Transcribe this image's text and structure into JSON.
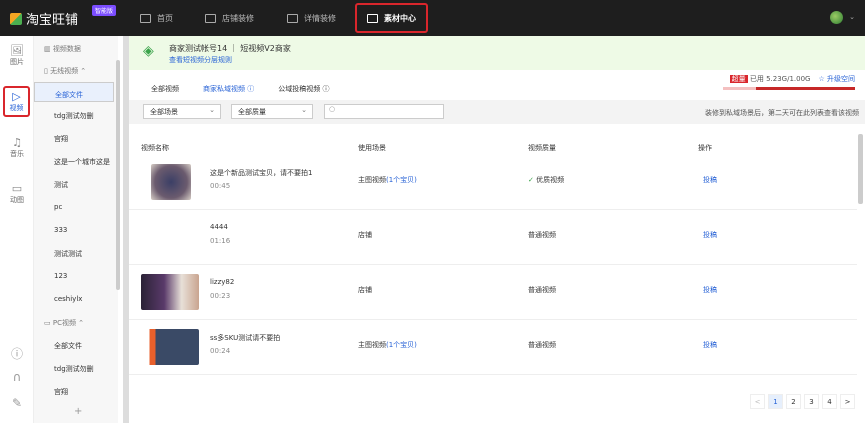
{
  "topbar": {
    "logo": "淘宝旺铺",
    "edition_badge": "智能版",
    "nav": [
      {
        "label": "首页",
        "icon": "home-icon"
      },
      {
        "label": "店铺装修",
        "icon": "store-icon"
      },
      {
        "label": "详情装修",
        "icon": "detail-icon"
      },
      {
        "label": "素材中心",
        "icon": "folder-icon",
        "active": true
      }
    ]
  },
  "rail": {
    "items": [
      {
        "label": "图片",
        "icon": "image-icon"
      },
      {
        "label": "视频",
        "icon": "video-icon",
        "active": true
      },
      {
        "label": "音乐",
        "icon": "music-icon"
      },
      {
        "label": "动图",
        "icon": "gif-icon"
      }
    ]
  },
  "sidebar": {
    "data_label": "视频数据",
    "wireless_group": "无线视频",
    "wireless_items": [
      "全部文件",
      "tdg测试勿删",
      "宫翔",
      "这是一个城市这是",
      "测试",
      "pc",
      "333",
      "测试测试",
      "123",
      "ceshiylx"
    ],
    "pc_group": "PC视频",
    "pc_items": [
      "全部文件",
      "tdg测试勿删",
      "宫翔"
    ],
    "add": "+"
  },
  "banner": {
    "title": "商家测试帐号14 ｜ 短视频V2商家",
    "link": "查看短视频分层规则"
  },
  "tabs": [
    "全部视频",
    "商家私域视频 ⓘ",
    "公域投稿视频 ⓘ"
  ],
  "quota": {
    "badge": "超量",
    "text": "已用 5.23G/1.00G",
    "upgrade": "☆ 升级空间",
    "used_fraction": 1.0
  },
  "filters": {
    "scene": "全部场景",
    "quality": "全部质量",
    "search_placeholder": "",
    "hint": "装修到私域场景后，第二天可在此列表查看该视频"
  },
  "table": {
    "headers": [
      "视频名称",
      "使用场景",
      "视频质量",
      "操作"
    ],
    "rows": [
      {
        "name": "这是个新品测试宝贝，请不要拍1",
        "duration": "00:45",
        "scene": "主图视频",
        "scene_link": "(1个宝贝)",
        "quality": "优质视频",
        "action": "投稿"
      },
      {
        "name": "4444",
        "duration": "01:16",
        "scene": "店铺",
        "scene_link": "",
        "quality": "普通视频",
        "action": "投稿"
      },
      {
        "name": "lizzy82",
        "duration": "00:23",
        "scene": "店铺",
        "scene_link": "",
        "quality": "普通视频",
        "action": "投稿"
      },
      {
        "name": "ss多SKU测试请不要拍",
        "duration": "00:24",
        "scene": "主图视频",
        "scene_link": "(1个宝贝)",
        "quality": "普通视频",
        "action": "投稿"
      }
    ]
  },
  "pagination": {
    "prev": "<",
    "pages": [
      "1",
      "2",
      "3",
      "4"
    ],
    "current": "1",
    "next": ">"
  }
}
